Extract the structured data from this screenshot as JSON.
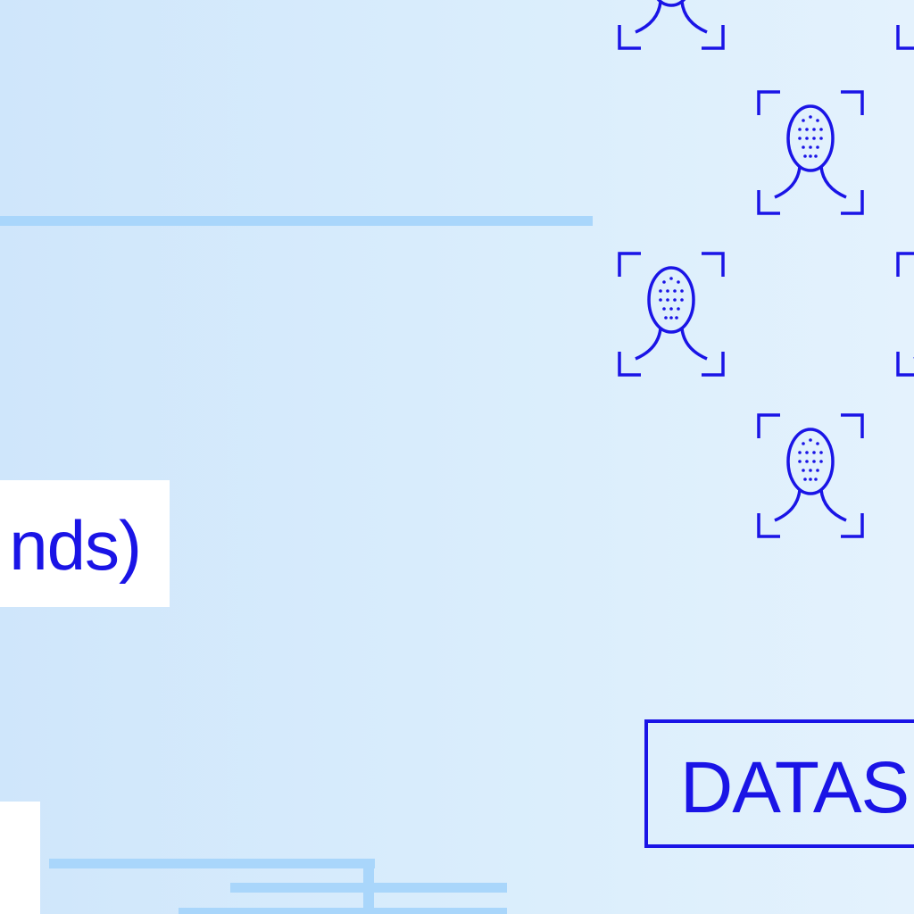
{
  "labels": {
    "seconds_fragment": "nds)",
    "dataset_fragment": "DATAS"
  },
  "icons": {
    "face": "face-scan-icon"
  },
  "colors": {
    "background_left": "#cfe6fb",
    "background_right": "#e4f2fd",
    "accent_blue": "#1a14e6",
    "connector_line": "#a9d6fb",
    "panel_white": "#ffffff"
  }
}
